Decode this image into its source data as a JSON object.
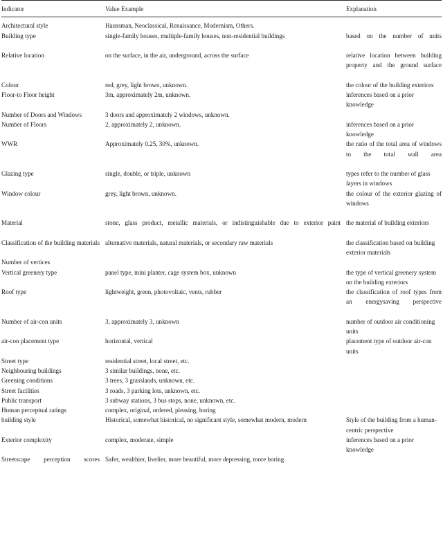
{
  "table": {
    "headers": {
      "indicator": "Indicator",
      "value_example": "Value Example",
      "explanation": "Explanation"
    },
    "rows": [
      {
        "indicator": "Architectural style",
        "value": "Haussman, Neoclassical, Renaissance, Modernism, Others.",
        "explanation": "",
        "indicator_justify": false,
        "value_justify": false,
        "explanation_justify": false
      },
      {
        "indicator": "Building type",
        "value": "single-family houses, multiple-family houses, non-residential buildings",
        "explanation": "based on the number of units",
        "indicator_justify": false,
        "value_justify": false,
        "explanation_justify": true
      },
      {
        "indicator": "Relative location",
        "value": "on the surface, in the air, underground, across the surface",
        "explanation": "relative location between building property and the ground surface",
        "indicator_justify": false,
        "value_justify": false,
        "explanation_justify": true
      },
      {
        "indicator": "Colour",
        "value": "red, grey, light brown, unknown.",
        "explanation": "the colour of the building ex­teriors",
        "indicator_justify": false,
        "value_justify": false,
        "explanation_justify": false
      },
      {
        "indicator": "Floor-to Floor height",
        "value": "3m, approximately 2m, unknown.",
        "explanation": "inferences based on a prior knowledge",
        "indicator_justify": false,
        "value_justify": false,
        "explanation_justify": false
      },
      {
        "indicator": "Number of Doors and Win­dows",
        "value": "3 doors and approximately 2 windows, unknown.",
        "explanation": "",
        "indicator_justify": false,
        "value_justify": false,
        "explanation_justify": false
      },
      {
        "indicator": "Number of Floors",
        "value": "2, approximately 2, unknown.",
        "explanation": "inferences based on a prior knowledge",
        "indicator_justify": false,
        "value_justify": false,
        "explanation_justify": false
      },
      {
        "indicator": "WWR",
        "value": "Approximately 0.25, 30%, unknown.",
        "explanation": "the ratio of the total area of windows to the total wall area",
        "indicator_justify": false,
        "value_justify": false,
        "explanation_justify": true
      },
      {
        "indicator": "Glazing type",
        "value": "single, double, or triple, unknown",
        "explanation": "types refer to the number of glass layers in windows",
        "indicator_justify": false,
        "value_justify": false,
        "explanation_justify": false
      },
      {
        "indicator": "Window colour",
        "value": "grey, light brown, unknown.",
        "explanation": "the colour of the exterior glazing of windows",
        "indicator_justify": false,
        "value_justify": false,
        "explanation_justify": true
      },
      {
        "indicator": "Material",
        "value": "stone, glass product, metallic materials, or indistinguishable due to exterior paint",
        "explanation": "the material of building ex­teriors",
        "indicator_justify": false,
        "value_justify": true,
        "explanation_justify": false
      },
      {
        "indicator": "Classification of the build­ing materials",
        "value": "alternative materials, natural materials, or secondary raw materials",
        "explanation": "the classification based on building exterior materials",
        "indicator_justify": true,
        "value_justify": false,
        "explanation_justify": false
      },
      {
        "indicator": "Number of vertices",
        "value": "",
        "explanation": "",
        "indicator_justify": false,
        "value_justify": false,
        "explanation_justify": false
      },
      {
        "indicator": "Vertical greenery type",
        "value": "panel type, mini planter, cage system box, unknown",
        "explanation": "the type of vertical greenery system on the building exte­riors",
        "indicator_justify": false,
        "value_justify": false,
        "explanation_justify": false
      },
      {
        "indicator": "Roof type",
        "value": "lightweight, green, photovoltaic, vents, rubber",
        "explanation": "the classification of roof types from an energy­saving perspective",
        "indicator_justify": false,
        "value_justify": false,
        "explanation_justify": true
      },
      {
        "indicator": "Number of air-con units",
        "value": "3, approximately 3, unknown",
        "explanation": "number of outdoor air con­ditioning units",
        "indicator_justify": false,
        "value_justify": false,
        "explanation_justify": false
      },
      {
        "indicator": "air-con placement type",
        "value": "horizontal, vertical",
        "explanation": "placement type of outdoor air-con units",
        "indicator_justify": false,
        "value_justify": false,
        "explanation_justify": false
      },
      {
        "indicator": "Street type",
        "value": "residential street, local street, etc.",
        "explanation": "",
        "indicator_justify": false,
        "value_justify": false,
        "explanation_justify": false
      },
      {
        "indicator": "Neighbouring buildings",
        "value": "3 similar buildings, none, etc.",
        "explanation": "",
        "indicator_justify": false,
        "value_justify": false,
        "explanation_justify": false
      },
      {
        "indicator": "Greening conditions",
        "value": "3 trees, 3 grasslands, unknown, etc.",
        "explanation": "",
        "indicator_justify": false,
        "value_justify": false,
        "explanation_justify": false
      },
      {
        "indicator": "Street facilities",
        "value": "3 roads, 3 parking lots, unknown, etc.",
        "explanation": "",
        "indicator_justify": false,
        "value_justify": false,
        "explanation_justify": false
      },
      {
        "indicator": "Public transport",
        "value": "3 subway stations, 3 bus stops, none, unknown, etc.",
        "explanation": "",
        "indicator_justify": false,
        "value_justify": false,
        "explanation_justify": false
      },
      {
        "indicator": "Human perceptual ratings",
        "value": "complex, original, ordered, pleasing, boring",
        "explanation": "",
        "indicator_justify": false,
        "value_justify": false,
        "explanation_justify": false
      },
      {
        "indicator": "building style",
        "value": "Historical, somewhat historical, no significant style, somewhat modern, modern",
        "explanation": "Style of the building from a human-centric perspective",
        "indicator_justify": false,
        "value_justify": false,
        "explanation_justify": false
      },
      {
        "indicator": "Exterior complexity",
        "value": "complex, moderate, simple",
        "explanation": "inferences based on a prior knowledge",
        "indicator_justify": false,
        "value_justify": false,
        "explanation_justify": false
      },
      {
        "indicator": "Streetscape perception scores",
        "value": "Safer, wealthier, livelier, more beautiful, more depressing, more boring",
        "explanation": "",
        "indicator_justify": true,
        "value_justify": false,
        "explanation_justify": false
      }
    ]
  }
}
